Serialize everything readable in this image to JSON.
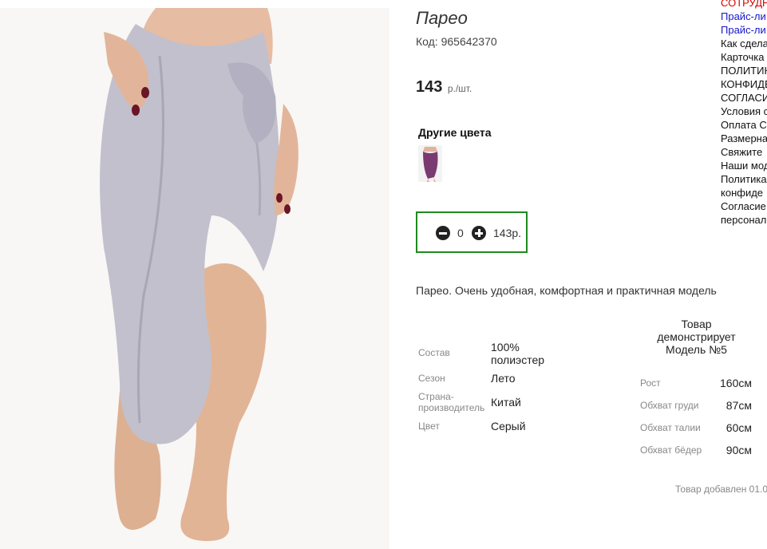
{
  "product": {
    "title": "Парео",
    "code_label": "Код:",
    "code_value": "965642370",
    "price_value": "143",
    "price_unit": "р./шт.",
    "other_colors_title": "Другие цвета",
    "description": "Парео. Очень удобная, комфортная и практичная модель",
    "added_text": "Товар добавлен 01.0"
  },
  "quantity": {
    "value": "0",
    "total": "143р."
  },
  "attributes": [
    {
      "label": "Состав",
      "value": "100% полиэстер"
    },
    {
      "label": "Сезон",
      "value": "Лето"
    },
    {
      "label": "Страна-производитель",
      "value": "Китай"
    },
    {
      "label": "Цвет",
      "value": "Серый"
    }
  ],
  "model": {
    "header": "Товар демонстрирует Модель №5",
    "measurements": [
      {
        "label": "Рост",
        "value": "160см"
      },
      {
        "label": "Обхват груди",
        "value": "87см"
      },
      {
        "label": "Обхват талии",
        "value": "60см"
      },
      {
        "label": "Обхват бёдер",
        "value": "90см"
      }
    ]
  },
  "sidebar": {
    "items": [
      {
        "label": "СОТРУДН",
        "style": "red"
      },
      {
        "label": "Прайс-ли",
        "style": "blue"
      },
      {
        "label": "Прайс-ли",
        "style": "blue"
      },
      {
        "label": "Как сдела",
        "style": "plain"
      },
      {
        "label": "Карточка",
        "style": "plain"
      },
      {
        "label": "ПОЛИТИК",
        "style": "plain"
      },
      {
        "label": "КОНФИДЕ",
        "style": "plain"
      },
      {
        "label": "СОГЛАСИ",
        "style": "plain"
      },
      {
        "label": "Условия с",
        "style": "plain"
      },
      {
        "label": "Оплата С",
        "style": "plain"
      },
      {
        "label": "Размерна",
        "style": "plain"
      },
      {
        "label": "Свяжите",
        "style": "plain"
      },
      {
        "label": "Наши мод",
        "style": "plain"
      },
      {
        "label": "Политика",
        "style": "plain"
      },
      {
        "label": "конфиде",
        "style": "plain"
      },
      {
        "label": "Согласие",
        "style": "plain"
      },
      {
        "label": "персонал",
        "style": "plain"
      }
    ]
  },
  "colors": {
    "skirt_main": "#c2c0cc",
    "skin": "#e3b79d",
    "nail": "#6b1526",
    "swatch_fabric": "#7b3a72",
    "qty_border": "#1e8a1e"
  }
}
